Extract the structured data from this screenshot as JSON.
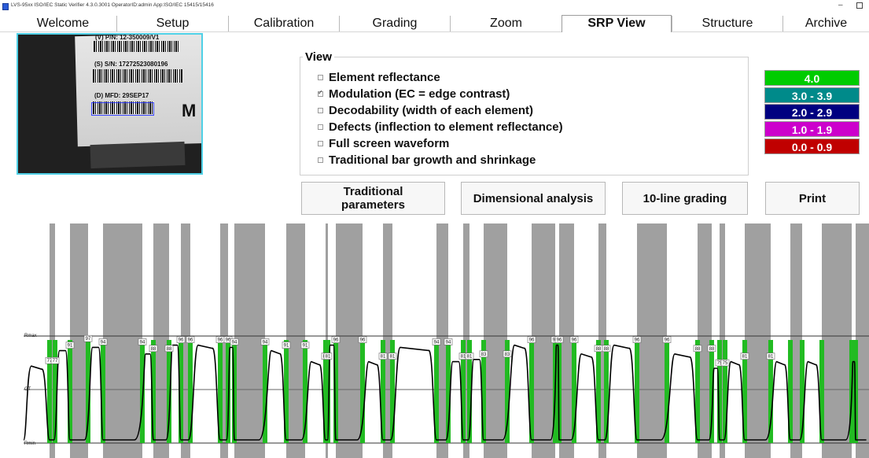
{
  "window": {
    "title": "LVS-95xx ISO/IEC Static Verifier 4.3.0.3001    OperatorID:admin    App:ISO/IEC 15415/15416",
    "minimize_glyph": "–"
  },
  "tabs": [
    {
      "label": "Welcome",
      "active": false
    },
    {
      "label": "Setup",
      "active": false
    },
    {
      "label": "Calibration",
      "active": false
    },
    {
      "label": "Grading",
      "active": false
    },
    {
      "label": "Zoom",
      "active": false
    },
    {
      "label": "SRP View",
      "active": true
    },
    {
      "label": "Structure",
      "active": false
    },
    {
      "label": "Archive",
      "active": false
    }
  ],
  "camera": {
    "line1": "(S) S/N: 17272523080196",
    "line2": "(D) MFD: 29SEP17",
    "line0": "(V) P/N: 12-350009/V1",
    "big_letter": "M"
  },
  "view": {
    "legend": "View",
    "options": [
      {
        "label": "Element reflectance",
        "checked": false
      },
      {
        "label": "Modulation (EC = edge contrast)",
        "checked": true
      },
      {
        "label": "Decodability (width of each element)",
        "checked": false
      },
      {
        "label": "Defects (inflection to element reflectance)",
        "checked": false
      },
      {
        "label": "Full screen waveform",
        "checked": false
      },
      {
        "label": "Traditional bar growth and shrinkage",
        "checked": false
      }
    ]
  },
  "grades": [
    {
      "label": "4.0",
      "color": "#00cc00"
    },
    {
      "label": "3.0 - 3.9",
      "color": "#008a8a"
    },
    {
      "label": "2.0 - 2.9",
      "color": "#000080"
    },
    {
      "label": "1.0 - 1.9",
      "color": "#cc00cc"
    },
    {
      "label": "0.0 - 0.9",
      "color": "#c00000"
    }
  ],
  "buttons": {
    "traditional_line1": "Traditional",
    "traditional_line2": "parameters",
    "dimensional": "Dimensional analysis",
    "ten_line": "10-line grading",
    "print": "Print"
  },
  "waveform": {
    "labels": {
      "rmax": "Rmax",
      "gt": "GT",
      "rmin": "Rmin"
    },
    "colors": {
      "space": "#ffffff",
      "bar": "#a0a0a0",
      "edge": "#22bb22",
      "trace": "#000000"
    },
    "boundaries": [
      0,
      33,
      40,
      59,
      82,
      101,
      151,
      165,
      185,
      200,
      212,
      250,
      260,
      268,
      307,
      334,
      358,
      384,
      387,
      397,
      431,
      457,
      469,
      525,
      540,
      559,
      567,
      585,
      615,
      646,
      676,
      681,
      700,
      731,
      741,
      780,
      818,
      857,
      875,
      885,
      892,
      917,
      950,
      975,
      990,
      1015,
      1053,
      1058,
      1075
    ],
    "ec_values": [
      77,
      77,
      91,
      97,
      94,
      94,
      88,
      88,
      96,
      96,
      96,
      96,
      94,
      94,
      91,
      91,
      81,
      81,
      96,
      96,
      81,
      81,
      94,
      94,
      81,
      81,
      83,
      83,
      96,
      96,
      96,
      96,
      88,
      88,
      96,
      96,
      88,
      88,
      75,
      75,
      81,
      81
    ]
  }
}
